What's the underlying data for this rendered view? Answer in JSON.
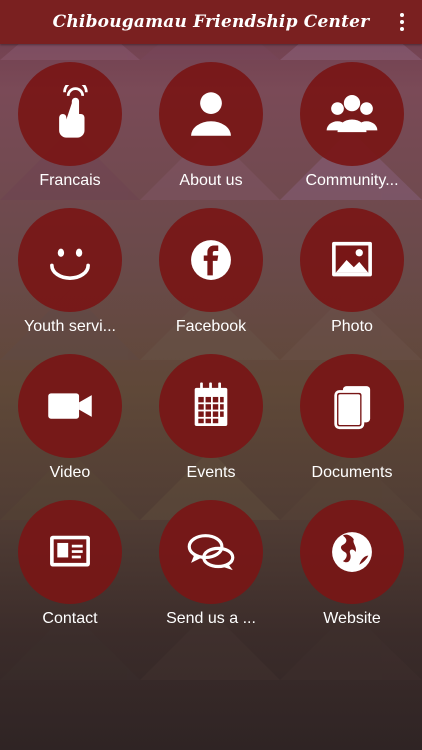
{
  "app": {
    "title": "Chibougamau Friendship Center"
  },
  "tiles": [
    {
      "label": "Francais",
      "icon": "touch-icon"
    },
    {
      "label": "About us",
      "icon": "person-icon"
    },
    {
      "label": "Community...",
      "icon": "group-icon"
    },
    {
      "label": "Youth servi...",
      "icon": "smiley-icon"
    },
    {
      "label": "Facebook",
      "icon": "facebook-icon"
    },
    {
      "label": "Photo",
      "icon": "photo-icon"
    },
    {
      "label": "Video",
      "icon": "video-icon"
    },
    {
      "label": "Events",
      "icon": "calendar-icon"
    },
    {
      "label": "Documents",
      "icon": "documents-icon"
    },
    {
      "label": "Contact",
      "icon": "contact-card-icon"
    },
    {
      "label": "Send us a ...",
      "icon": "chat-icon"
    },
    {
      "label": "Website",
      "icon": "globe-icon"
    }
  ],
  "colors": {
    "appbar": "#7a2020",
    "tile": "#781616"
  }
}
